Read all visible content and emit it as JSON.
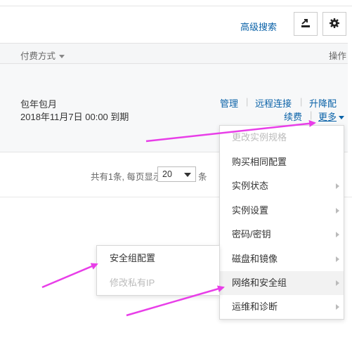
{
  "toolbar": {
    "advanced_search": "高级搜索",
    "export_icon": "export-icon",
    "settings_icon": "gear-icon"
  },
  "table": {
    "headers": {
      "billing": "付费方式",
      "operations": "操作"
    },
    "row": {
      "billing_type": "包年包月",
      "expire_date": "2018年11月7日 00:00",
      "expire_suffix": "到期",
      "actions": {
        "manage": "管理",
        "remote": "远程连接",
        "upgrade": "升降配",
        "renew": "续费",
        "more": "更多"
      }
    }
  },
  "pagination": {
    "summary": "共有1条, 每页显示:",
    "page_size": "20",
    "unit": "条"
  },
  "more_menu": {
    "items": [
      {
        "label": "更改实例规格",
        "disabled": true,
        "has_sub": false
      },
      {
        "label": "购买相同配置",
        "disabled": false,
        "has_sub": false
      },
      {
        "label": "实例状态",
        "disabled": false,
        "has_sub": true
      },
      {
        "label": "实例设置",
        "disabled": false,
        "has_sub": true
      },
      {
        "label": "密码/密钥",
        "disabled": false,
        "has_sub": true
      },
      {
        "label": "磁盘和镜像",
        "disabled": false,
        "has_sub": true
      },
      {
        "label": "网络和安全组",
        "disabled": false,
        "has_sub": true,
        "active": true
      },
      {
        "label": "运维和诊断",
        "disabled": false,
        "has_sub": true
      }
    ]
  },
  "network_submenu": {
    "items": [
      {
        "label": "安全组配置",
        "disabled": false
      },
      {
        "label": "修改私有IP",
        "disabled": true
      }
    ]
  },
  "colors": {
    "link": "#0a62a8",
    "annotation_arrow": "#e83ee8",
    "disabled_text": "#bbbbbb"
  }
}
